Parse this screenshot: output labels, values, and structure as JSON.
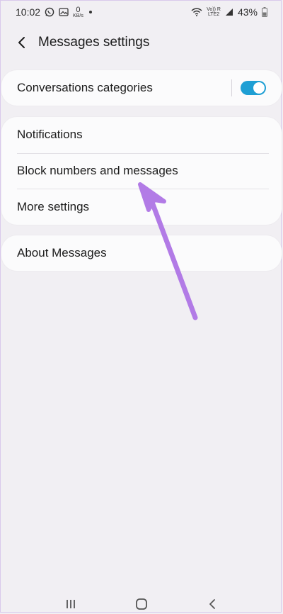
{
  "status_bar": {
    "time": "10:02",
    "speed_value": "0",
    "speed_unit": "KB/s",
    "network_label_top": "Vo)) R",
    "network_label_bottom": "LTE2",
    "battery_percent": "43%"
  },
  "header": {
    "title": "Messages settings"
  },
  "settings": {
    "group1": [
      {
        "label": "Conversations categories",
        "toggle_on": true
      }
    ],
    "group2": [
      {
        "label": "Notifications"
      },
      {
        "label": "Block numbers and messages"
      },
      {
        "label": "More settings"
      }
    ],
    "group3": [
      {
        "label": "About Messages"
      }
    ]
  },
  "colors": {
    "background": "#f1eff3",
    "card": "#fbfbfc",
    "toggle_accent": "#1f9fd4",
    "arrow": "#b27be6"
  },
  "icons": {
    "status_left": [
      "whatsapp-icon",
      "gallery-notification-icon",
      "network-speed-icon",
      "notification-dot-icon"
    ],
    "status_right": [
      "wifi-icon",
      "volte-lte-icon",
      "signal-icon",
      "battery-icon"
    ],
    "header": "back-arrow-icon",
    "nav": [
      "recent-apps-icon",
      "home-icon",
      "back-icon"
    ]
  }
}
